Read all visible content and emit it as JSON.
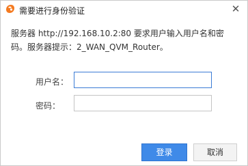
{
  "window": {
    "title": "需要进行身份验证",
    "close_glyph": "✕",
    "app_icon": "uc-browser-icon",
    "close_icon": "close-icon"
  },
  "message": {
    "line1": "服务器 http://192.168.10.2:80 要求用户输入用户名和密",
    "line2": "码。服务器提示：2_WAN_QVM_Router。"
  },
  "form": {
    "username_label": "用户名：",
    "username_value": "",
    "password_label": "密码：",
    "password_value": ""
  },
  "buttons": {
    "login_label": "登录",
    "cancel_label": "取消"
  },
  "colors": {
    "accent": "#3f8ae8",
    "input_focus_border": "#3a7bd5",
    "icon_orange": "#f47a20"
  }
}
